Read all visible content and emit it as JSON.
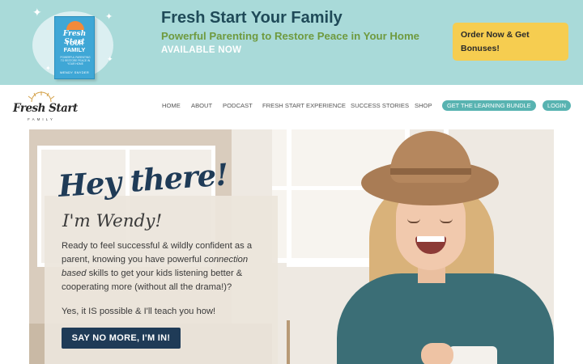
{
  "banner": {
    "title": "Fresh Start Your Family",
    "subtitle": "Powerful Parenting to Restore Peace in Your Home",
    "availability": "AVAILABLE NOW",
    "order_button": "Order Now & Get Bonuses!",
    "background_color": "#a9dad9",
    "book": {
      "script_title": "Fresh Start",
      "title_line1": "YOUR",
      "title_line2": "FAMILY",
      "subtitle": "POWERFUL PARENTING TO RESTORE PEACE IN YOUR HOME",
      "author": "WENDY SNYDER"
    }
  },
  "logo": {
    "script": "Fresh Start",
    "word": "FAMILY"
  },
  "nav": {
    "items": [
      "HOME",
      "ABOUT",
      "PODCAST",
      "FRESH START EXPERIENCE",
      "SUCCESS STORIES",
      "SHOP"
    ],
    "bundle_button": "GET THE LEARNING BUNDLE",
    "login_button": "LOGIN",
    "pill_color": "#58b3b1"
  },
  "hero": {
    "greeting": "Hey there!",
    "name_line": "I'm Wendy!",
    "intro_part1": "Ready to feel successful & wildly confident as a parent, knowing you have powerful ",
    "intro_emphasis": "connection based",
    "intro_part2": " skills to get your kids listening better & cooperating more (without all the drama!)?",
    "promise": "Yes, it IS possible & I'll teach you how!",
    "cta_button": "SAY NO MORE, I'M IN!",
    "accent_color": "#1f3b57"
  }
}
